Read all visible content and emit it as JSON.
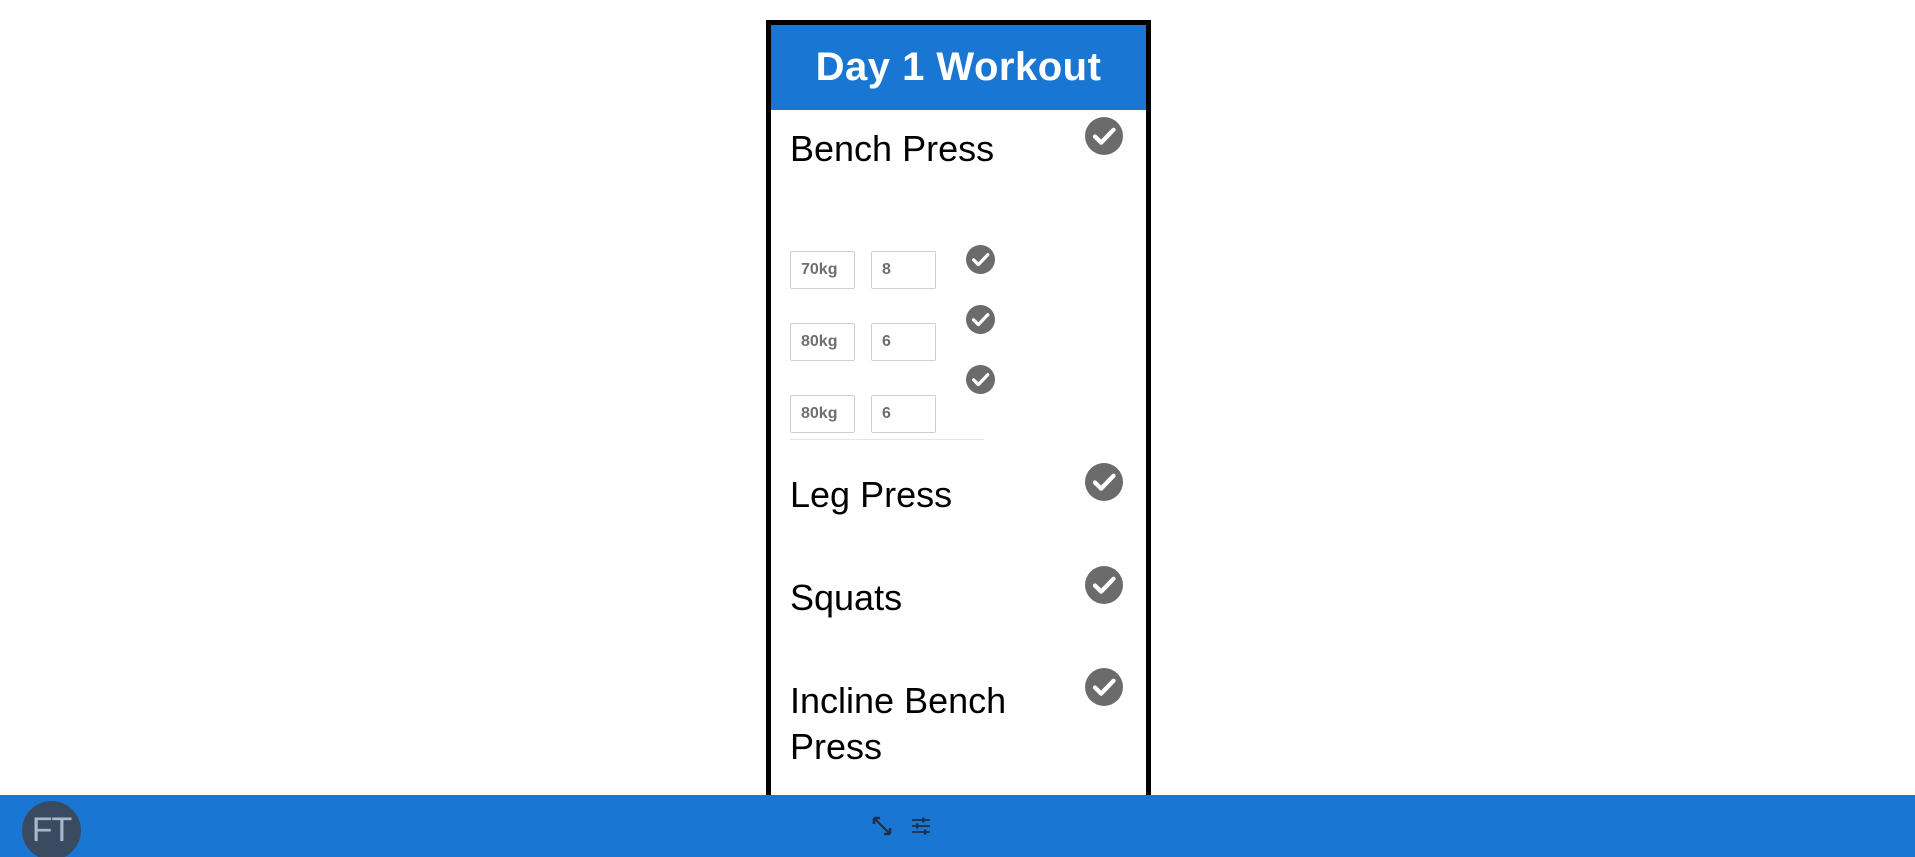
{
  "workout": {
    "title": "Day 1 Workout",
    "exercises": [
      {
        "name": "Bench Press",
        "sets": [
          {
            "weight": "70kg",
            "reps": "8"
          },
          {
            "weight": "80kg",
            "reps": "6"
          },
          {
            "weight": "80kg",
            "reps": "6"
          }
        ]
      },
      {
        "name": "Leg Press"
      },
      {
        "name": "Squats"
      },
      {
        "name": "Incline Bench Press"
      }
    ]
  },
  "taskbar": {
    "avatar_initials": "FT",
    "icons": [
      "expand-arrows-icon",
      "sliders-icon"
    ]
  },
  "colors": {
    "header_blue": "#1a76d3",
    "check_gray": "#6b6b6b",
    "avatar_bg": "#3a4b61"
  }
}
